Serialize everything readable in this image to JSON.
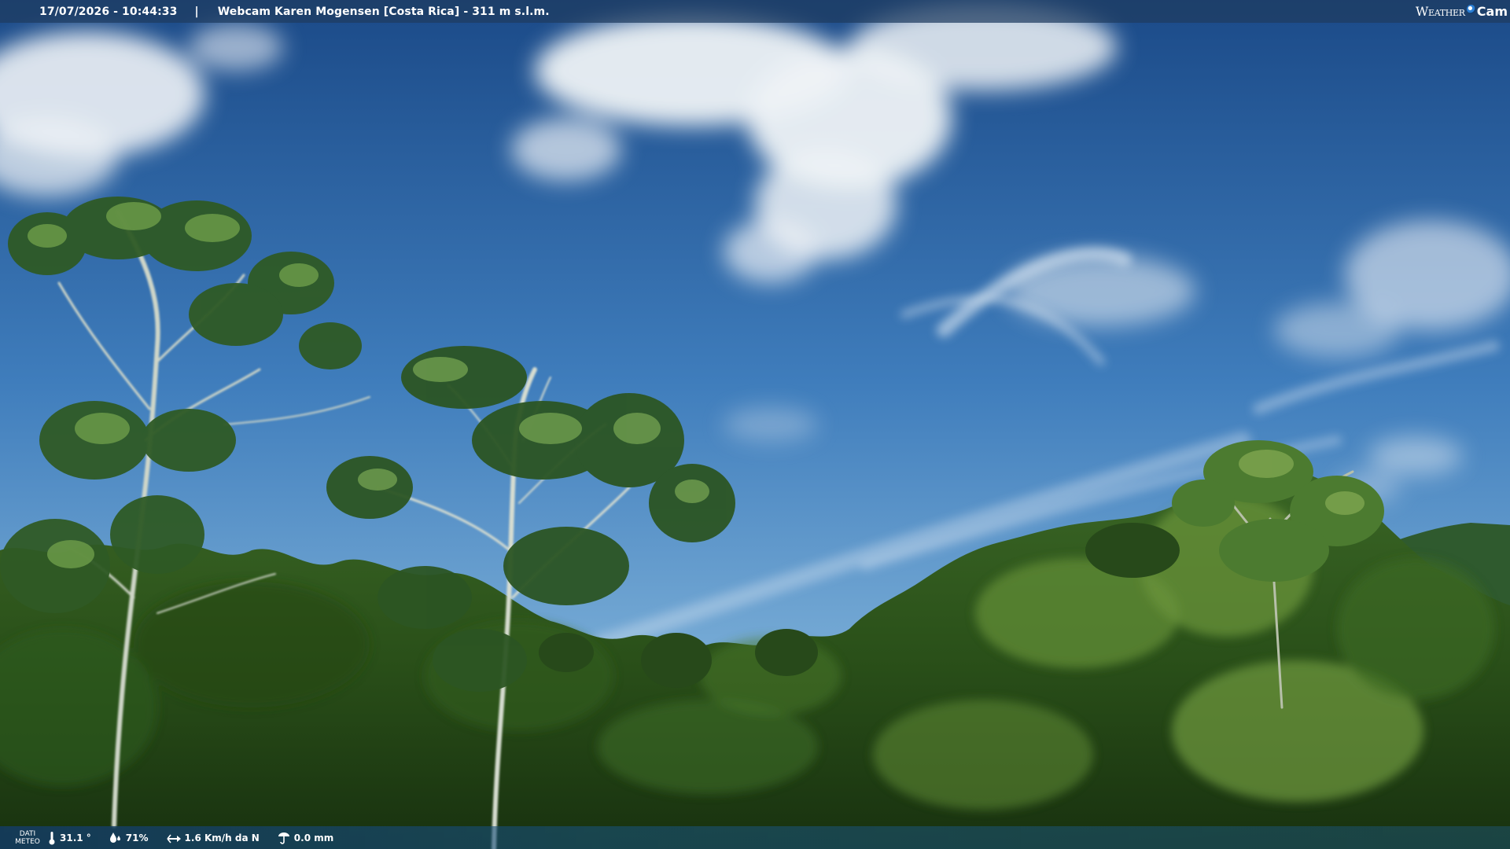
{
  "overlay": {
    "timestamp": "17/07/2026 - 10:44:33",
    "separator": "|",
    "station_title": "Webcam Karen Mogensen [Costa Rica] - 311 m s.l.m."
  },
  "logo": {
    "brand_a": "Weather",
    "brand_b": "Cam"
  },
  "weather": {
    "label_line1": "DATI",
    "label_line2": "METEO",
    "temperature": "31.1 °",
    "humidity": "71%",
    "wind": "1.6 Km/h da N",
    "rain": "0.0 mm"
  },
  "icons": {
    "temperature": "thermometer-icon",
    "humidity": "droplet-icon",
    "wind": "wind-vane-icon",
    "rain": "rain-gauge-icon"
  },
  "colors": {
    "sky_top": "#1d4f8f",
    "sky_horizon": "#6fa6d4",
    "cloud": "#eef2f6",
    "foliage_dark": "#1f3f16",
    "foliage_mid": "#3f6b26",
    "foliage_light": "#7aa146",
    "bar": "#1e3c60"
  }
}
